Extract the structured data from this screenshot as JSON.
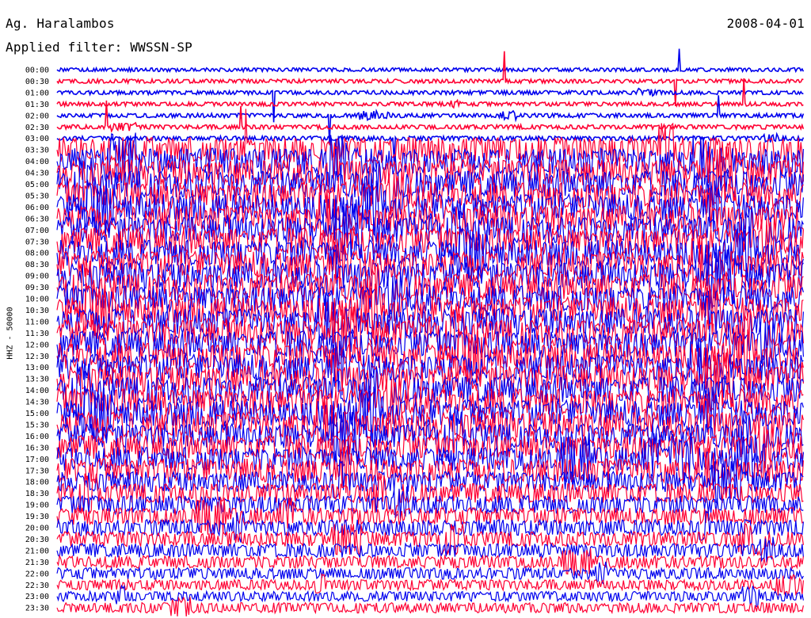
{
  "header": {
    "station": "Ag. Haralambos",
    "filter": "Applied filter: WWSSN-SP",
    "date": "2008-04-01"
  },
  "chart_data": {
    "type": "line",
    "title": "Ag. Haralambos",
    "subtitle": "Applied filter: WWSSN-SP",
    "date": "2008-04-01",
    "ylabel": "HHZ - 50000",
    "xlabel": "",
    "grid": false,
    "trace_colors": [
      "#0000ee",
      "#ff0033"
    ],
    "rows": [
      "00:00",
      "00:30",
      "01:00",
      "01:30",
      "02:00",
      "02:30",
      "03:00",
      "03:30",
      "04:00",
      "04:30",
      "05:00",
      "05:30",
      "06:00",
      "06:30",
      "07:00",
      "07:30",
      "08:00",
      "08:30",
      "09:00",
      "09:30",
      "10:00",
      "10:30",
      "11:00",
      "11:30",
      "12:00",
      "12:30",
      "13:00",
      "13:30",
      "14:00",
      "14:30",
      "15:00",
      "15:30",
      "16:00",
      "16:30",
      "17:00",
      "17:30",
      "18:00",
      "18:30",
      "19:00",
      "19:30",
      "20:00",
      "20:30",
      "21:00",
      "21:30",
      "22:00",
      "22:30",
      "23:00",
      "23:30"
    ],
    "noise_level": [
      0.1,
      0.12,
      0.12,
      0.12,
      0.14,
      0.14,
      0.16,
      0.95,
      1.0,
      1.0,
      1.0,
      1.0,
      1.0,
      1.0,
      1.0,
      1.0,
      1.0,
      1.0,
      1.0,
      1.0,
      1.0,
      1.0,
      1.0,
      1.0,
      1.0,
      1.0,
      1.0,
      1.0,
      1.0,
      1.0,
      1.0,
      1.0,
      0.9,
      0.9,
      0.9,
      0.9,
      0.75,
      0.7,
      0.65,
      0.6,
      0.55,
      0.5,
      0.45,
      0.4,
      0.35,
      0.3,
      0.28,
      0.3
    ]
  }
}
